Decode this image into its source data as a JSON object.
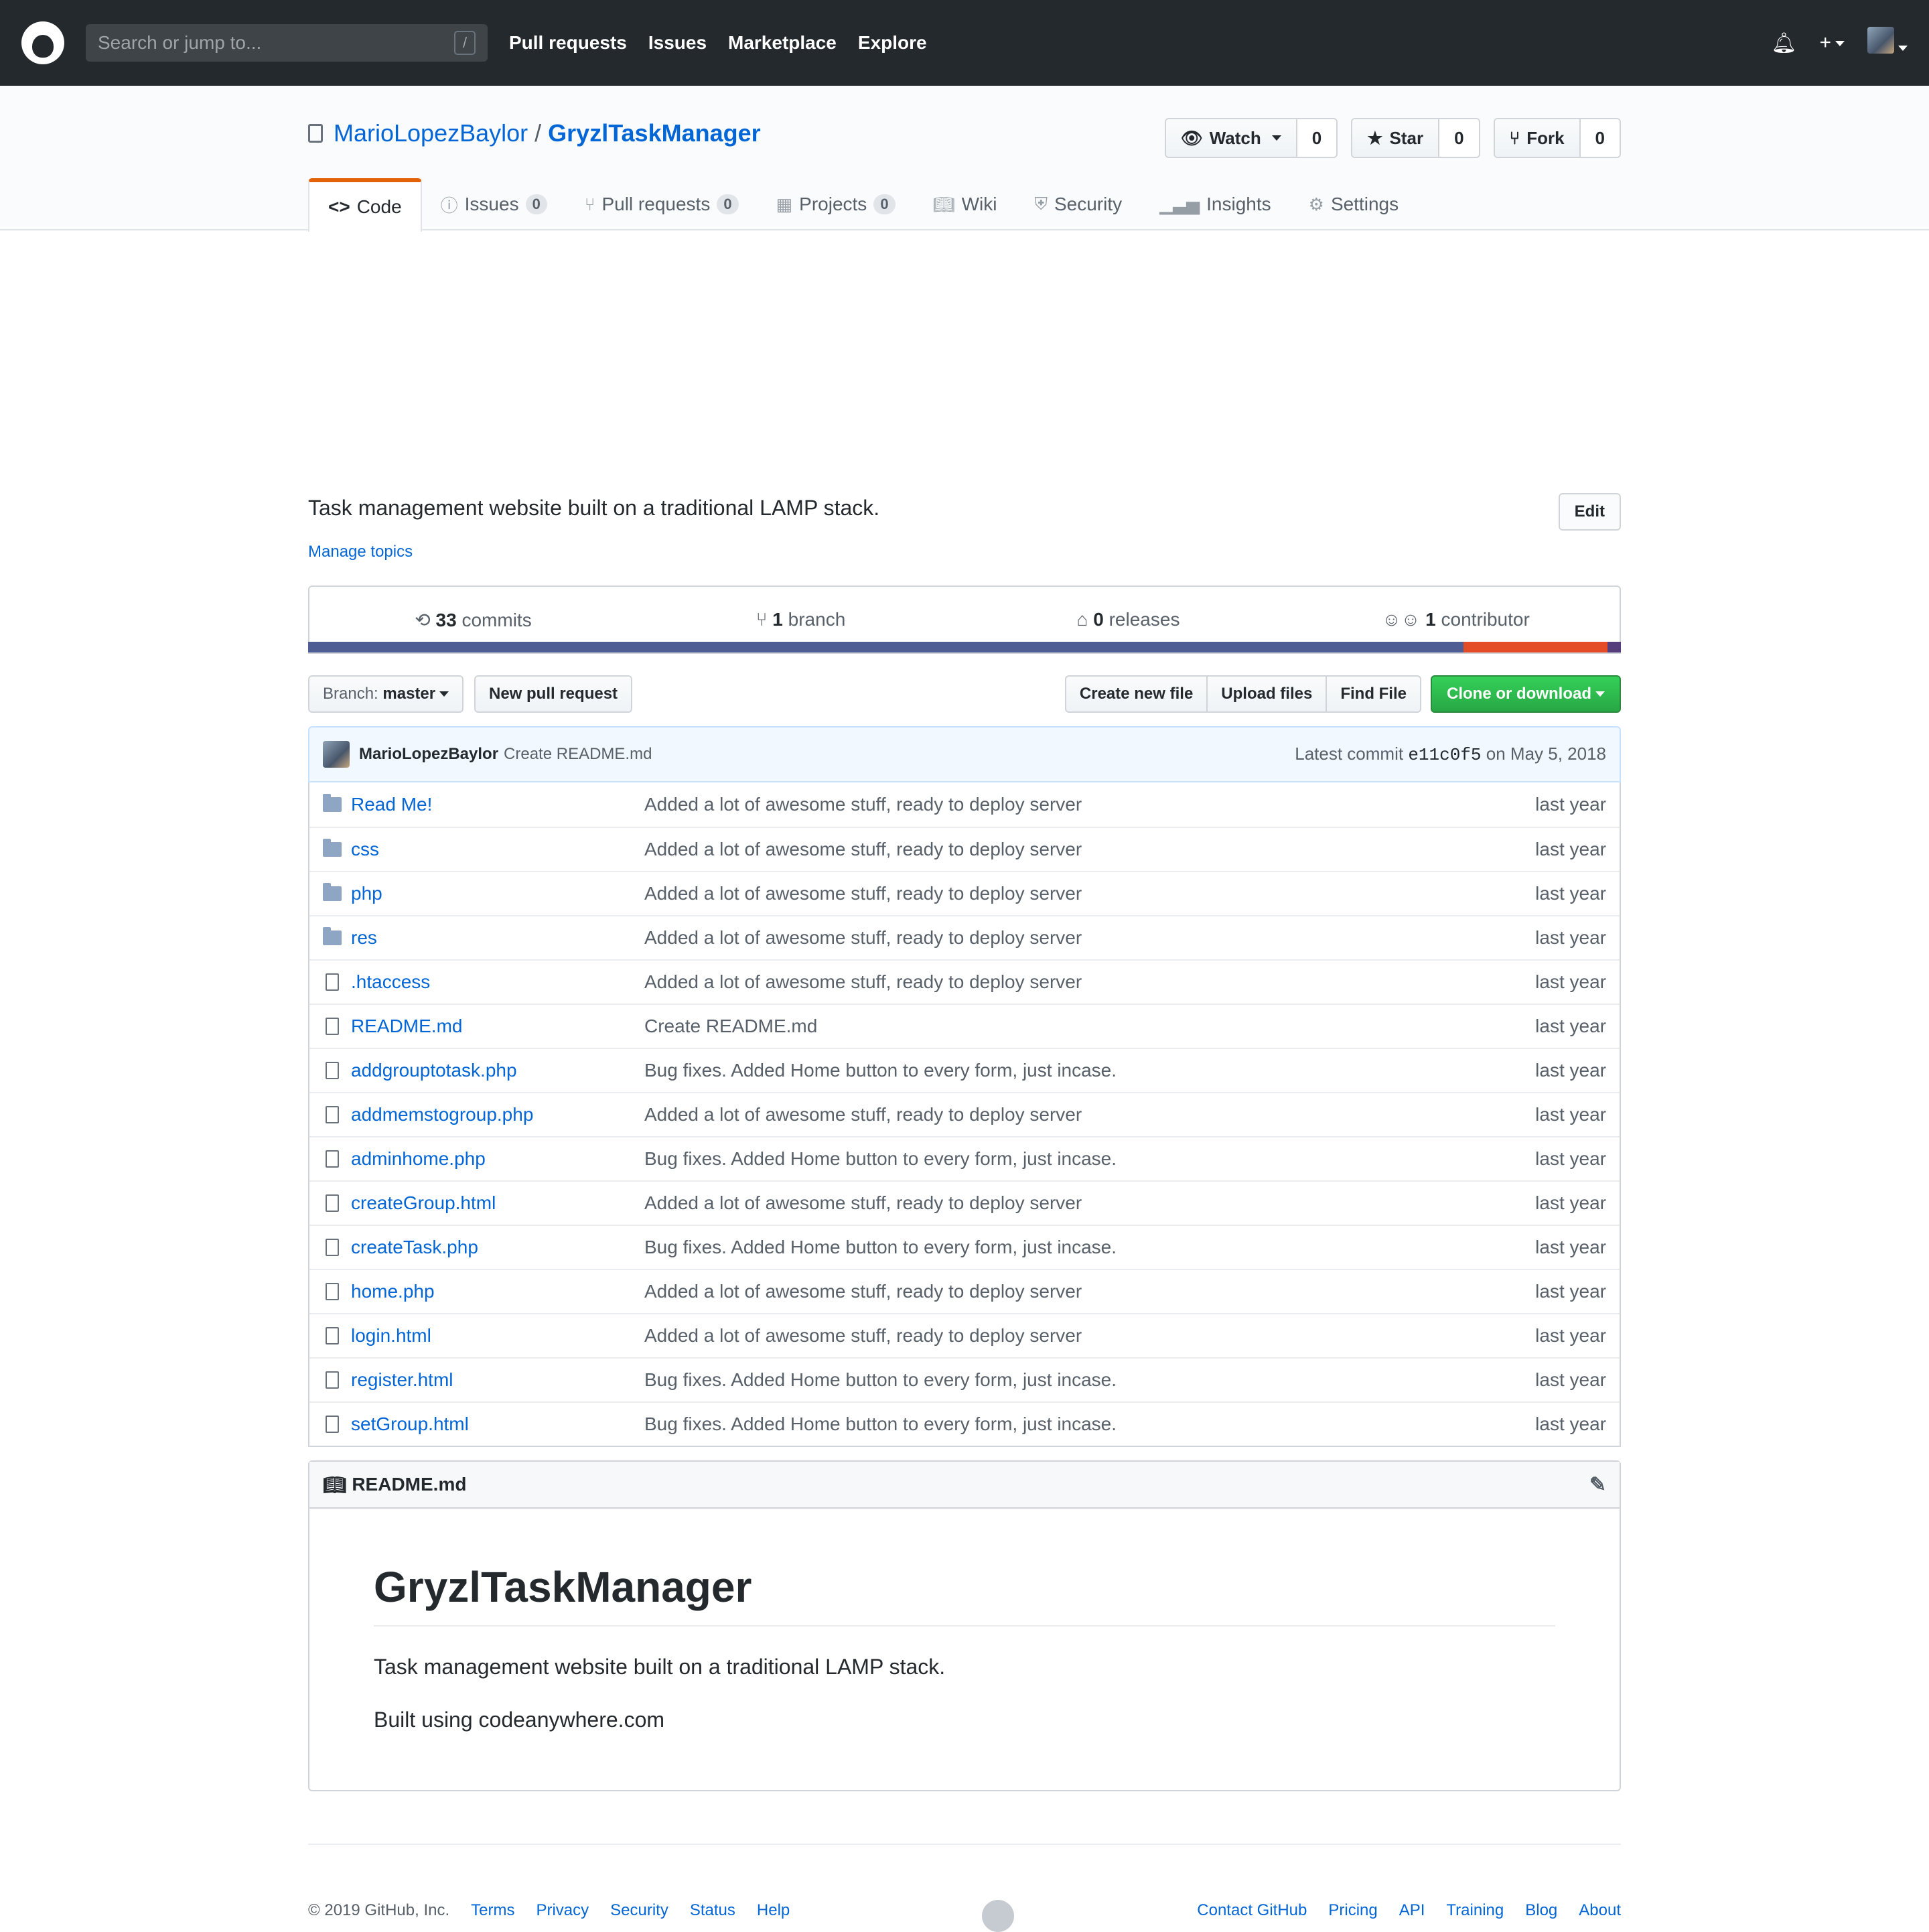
{
  "header": {
    "search_placeholder": "Search or jump to...",
    "search_key": "/",
    "nav": [
      "Pull requests",
      "Issues",
      "Marketplace",
      "Explore"
    ],
    "plus": "+"
  },
  "repo": {
    "owner": "MarioLopezBaylor",
    "separator": "/",
    "name": "GryzlTaskManager",
    "watch_label": "Watch",
    "watch_count": "0",
    "star_label": "Star",
    "star_count": "0",
    "fork_label": "Fork",
    "fork_count": "0"
  },
  "tabs": [
    {
      "label": "Code",
      "icon": "<>"
    },
    {
      "label": "Issues",
      "count": "0"
    },
    {
      "label": "Pull requests",
      "count": "0"
    },
    {
      "label": "Projects",
      "count": "0"
    },
    {
      "label": "Wiki"
    },
    {
      "label": "Security"
    },
    {
      "label": "Insights"
    },
    {
      "label": "Settings"
    }
  ],
  "about": {
    "description": "Task management website built on a traditional LAMP stack.",
    "edit_label": "Edit",
    "topics_label": "Manage topics"
  },
  "summary": {
    "commits_num": "33",
    "commits_label": "commits",
    "branch_num": "1",
    "branch_label": "branch",
    "releases_num": "0",
    "releases_label": "releases",
    "contributor_num": "1",
    "contributor_label": "contributor"
  },
  "langbar": [
    {
      "color": "#4F5D95",
      "fraction": 0.88
    },
    {
      "color": "#e34c26",
      "fraction": 0.11
    },
    {
      "color": "#563d7c",
      "fraction": 0.01
    }
  ],
  "filenav": {
    "branch_prefix": "Branch:",
    "branch_name": "master",
    "new_pr": "New pull request",
    "create_file": "Create new file",
    "upload": "Upload files",
    "find": "Find File",
    "clone": "Clone or download"
  },
  "commit": {
    "author": "MarioLopezBaylor",
    "message": "Create README.md",
    "latest_prefix": "Latest commit",
    "sha": "e11c0f5",
    "date_text": "on May 5, 2018"
  },
  "files": [
    {
      "type": "dir",
      "name": "Read Me!",
      "message": "Added a lot of awesome stuff, ready to deploy server",
      "age": "last year"
    },
    {
      "type": "dir",
      "name": "css",
      "message": "Added a lot of awesome stuff, ready to deploy server",
      "age": "last year"
    },
    {
      "type": "dir",
      "name": "php",
      "message": "Added a lot of awesome stuff, ready to deploy server",
      "age": "last year"
    },
    {
      "type": "dir",
      "name": "res",
      "message": "Added a lot of awesome stuff, ready to deploy server",
      "age": "last year"
    },
    {
      "type": "file",
      "name": ".htaccess",
      "message": "Added a lot of awesome stuff, ready to deploy server",
      "age": "last year"
    },
    {
      "type": "file",
      "name": "README.md",
      "message": "Create README.md",
      "age": "last year"
    },
    {
      "type": "file",
      "name": "addgrouptotask.php",
      "message": "Bug fixes. Added Home button to every form, just incase.",
      "age": "last year"
    },
    {
      "type": "file",
      "name": "addmemstogroup.php",
      "message": "Added a lot of awesome stuff, ready to deploy server",
      "age": "last year"
    },
    {
      "type": "file",
      "name": "adminhome.php",
      "message": "Bug fixes. Added Home button to every form, just incase.",
      "age": "last year"
    },
    {
      "type": "file",
      "name": "createGroup.html",
      "message": "Added a lot of awesome stuff, ready to deploy server",
      "age": "last year"
    },
    {
      "type": "file",
      "name": "createTask.php",
      "message": "Bug fixes. Added Home button to every form, just incase.",
      "age": "last year"
    },
    {
      "type": "file",
      "name": "home.php",
      "message": "Added a lot of awesome stuff, ready to deploy server",
      "age": "last year"
    },
    {
      "type": "file",
      "name": "login.html",
      "message": "Added a lot of awesome stuff, ready to deploy server",
      "age": "last year"
    },
    {
      "type": "file",
      "name": "register.html",
      "message": "Bug fixes. Added Home button to every form, just incase.",
      "age": "last year"
    },
    {
      "type": "file",
      "name": "setGroup.html",
      "message": "Bug fixes. Added Home button to every form, just incase.",
      "age": "last year"
    }
  ],
  "readme": {
    "filename": "README.md",
    "title": "GryzlTaskManager",
    "para1": "Task management website built on a traditional LAMP stack.",
    "para2": "Built using codeanywhere.com"
  },
  "footer": {
    "copyright": "© 2019 GitHub, Inc.",
    "left_links": [
      "Terms",
      "Privacy",
      "Security",
      "Status",
      "Help"
    ],
    "right_links": [
      "Contact GitHub",
      "Pricing",
      "API",
      "Training",
      "Blog",
      "About"
    ]
  }
}
